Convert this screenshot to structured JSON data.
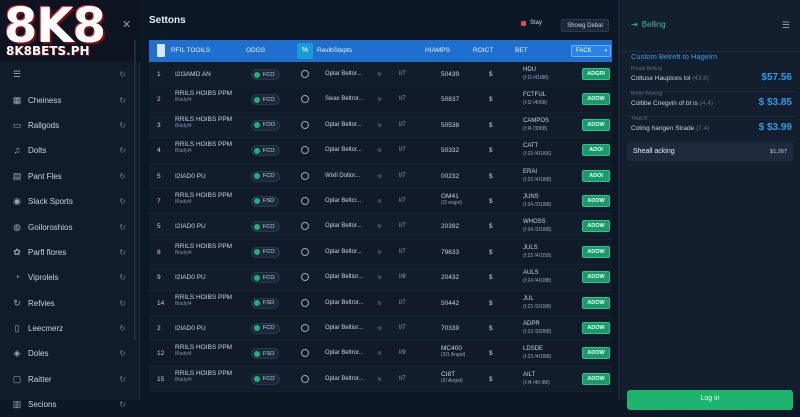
{
  "brand": {
    "logo": "8K8",
    "domain": "8K8BETS.PH",
    "close": "✕"
  },
  "sidebar": {
    "items": [
      {
        "label": "",
        "icon": "list-icon"
      },
      {
        "label": "Cheiness",
        "icon": "grid-icon"
      },
      {
        "label": "Rallgods",
        "icon": "monitor-icon"
      },
      {
        "label": "Dolts",
        "icon": "music-icon"
      },
      {
        "label": "Pant Fles",
        "icon": "folder-icon"
      },
      {
        "label": "Slack Sports",
        "icon": "ball-icon"
      },
      {
        "label": "Goiloroshios",
        "icon": "globe-icon"
      },
      {
        "label": "Parfl flores",
        "icon": "flower-icon"
      },
      {
        "label": "Viprolels",
        "icon": "user-icon"
      },
      {
        "label": "Refvies",
        "icon": "refresh-icon"
      },
      {
        "label": "Leecmerz",
        "icon": "doc-icon"
      },
      {
        "label": "Doles",
        "icon": "shield-icon"
      },
      {
        "label": "Raitter",
        "icon": "chat-icon"
      },
      {
        "label": "Secions",
        "icon": "chart-icon"
      }
    ]
  },
  "main": {
    "title": "Settons",
    "stay": "Stay",
    "detail_button": "Showg Debal",
    "columns": {
      "col1": "RFIL TOOILS",
      "col2": "ODGS",
      "pct": "%",
      "col3": "RevibStepts",
      "col4": "HIAMPS",
      "col5": "ROICT",
      "col6": "BET",
      "back": "FACK"
    },
    "rows": [
      {
        "num": "1",
        "name": "I2I3AMD AN",
        "sub": "",
        "tag": "FCO",
        "desc": "Oplar Beltor...",
        "v": "I/7",
        "n": "50439",
        "d": "$",
        "bet": "HDU",
        "bet_sub": "(I:I3 /41I88)",
        "action": "ADGRI"
      },
      {
        "num": "2",
        "name": "RRILS HOIBS PPM",
        "sub": "Bladyt4",
        "tag": "FCO",
        "desc": "Swax Beltror...",
        "v": "I/7",
        "n": "50837",
        "d": "$",
        "bet": "FCTFUL",
        "bet_sub": "(I:I2 /4II68)",
        "action": "ADOW"
      },
      {
        "num": "3",
        "name": "RRILS HOIBS PPM",
        "sub": "Bladyt4",
        "tag": "FOO",
        "desc": "Oplar Beltor...",
        "v": "I/7",
        "n": "50538",
        "d": "$",
        "bet": "CAMPOS",
        "bet_sub": "(I:I4 /3II88)",
        "action": "ADOW"
      },
      {
        "num": "4",
        "name": "RRILS HOIBS PPM",
        "sub": "Bladyt4",
        "tag": "FCO",
        "desc": "Oplar Beltor...",
        "v": "I/7",
        "n": "50332",
        "d": "$",
        "bet": "CATT",
        "bet_sub": "(I:23 /4I1I66)",
        "action": "ADOI"
      },
      {
        "num": "5",
        "name": "I2IAD0 PU",
        "sub": "",
        "tag": "FCO",
        "desc": "Wixll Doltor...",
        "v": "I/7",
        "n": "00232",
        "d": "$",
        "bet": "ERAI",
        "bet_sub": "(I:23 /4I1I88)",
        "action": "ADOI"
      },
      {
        "num": "7",
        "name": "RRILS HOIBS PPM",
        "sub": "Bladyt4",
        "tag": "FSO",
        "desc": "Oplar Beltcr...",
        "v": "I/7",
        "n": "GM41",
        "n_sub": "(I3 ezgot)",
        "d": "$",
        "bet": "JUNS",
        "bet_sub": "(I:34 /3I1I88)",
        "action": "ADOW"
      },
      {
        "num": "5",
        "name": "I2IAD0 PU",
        "sub": "",
        "tag": "FCO",
        "desc": "Oplar Beltor...",
        "v": "I/7",
        "n": "20392",
        "d": "$",
        "bet": "WHOSS",
        "bet_sub": "(I:34 /3I1I88)",
        "action": "ADOW"
      },
      {
        "num": "8",
        "name": "RRILS HOIBS PPM",
        "sub": "Bladyt4",
        "tag": "FCO",
        "desc": "Oplar Beltor...",
        "v": "I/7",
        "n": "79633",
        "d": "$",
        "bet": "JULS",
        "bet_sub": "(I:23 /4I1I58)",
        "action": "ADOW"
      },
      {
        "num": "9",
        "name": "I2IAD0 PU",
        "sub": "",
        "tag": "FCO",
        "desc": "Oplar Beltior...",
        "v": "I/8",
        "n": "20432",
        "d": "$",
        "bet": "AULS",
        "bet_sub": "(I:24 /4I1I88)",
        "action": "ADOW"
      },
      {
        "num": "14",
        "name": "RRILS HOIBS PPM",
        "sub": "Bladyt4",
        "tag": "FSO",
        "desc": "Oplar Beltror...",
        "v": "I/7",
        "n": "50442",
        "d": "$",
        "bet": "JUL",
        "bet_sub": "(I:23 /3I1I88)",
        "action": "ADOW"
      },
      {
        "num": "2",
        "name": "I2IAD0 PU",
        "sub": "",
        "tag": "FCO",
        "desc": "Oplar Beltior...",
        "v": "I/7",
        "n": "70339",
        "d": "$",
        "bet": "ADPR",
        "bet_sub": "(I:23 /3I2I88)",
        "action": "ADOW"
      },
      {
        "num": "12",
        "name": "RRILS HOIBS PPM",
        "sub": "Bladyt4",
        "tag": "FSO",
        "desc": "Oplar Beltror...",
        "v": "I/9",
        "n": "MC400",
        "n_sub": "(3I1 Angot)",
        "d": "$",
        "bet": "LDSDE",
        "bet_sub": "(I:23 /4I1I88)",
        "action": "ADOW"
      },
      {
        "num": "15",
        "name": "RRILS HOIBS PPM",
        "sub": "Bladyt4",
        "tag": "FCO",
        "desc": "Oplar Beltror...",
        "v": "I/7",
        "n": "CI8T",
        "n_sub": "(3I Angot)",
        "d": "$",
        "bet": "AILT",
        "bet_sub": "(I:I4 /4II I88)",
        "action": "ADOW"
      }
    ]
  },
  "betslip": {
    "title": "Belling",
    "section_title": "Custom Belrett to Hageirn",
    "cards": [
      {
        "small": "Priodo Belling",
        "label": "Coltuse Haupices lol",
        "label_grey": "(43.6)",
        "amount": "$57.56"
      },
      {
        "small": "Bettio Wrocog",
        "label": "Coltibe Cnegvin of bt is",
        "label_grey": "(4.4)",
        "amount": "$ $3.85"
      },
      {
        "small": "Tinstl 8",
        "label": "Coting hangen Strade",
        "label_grey": "(7.4)",
        "amount": "$ $3.99"
      }
    ],
    "summary_label": "Sheall acking",
    "summary_value": "$1,267",
    "login_button": "Log in",
    "colors": {
      "accent_green": "#1cb46e",
      "accent_blue": "#1f6fcf",
      "amount_blue": "#2f9be8"
    }
  }
}
